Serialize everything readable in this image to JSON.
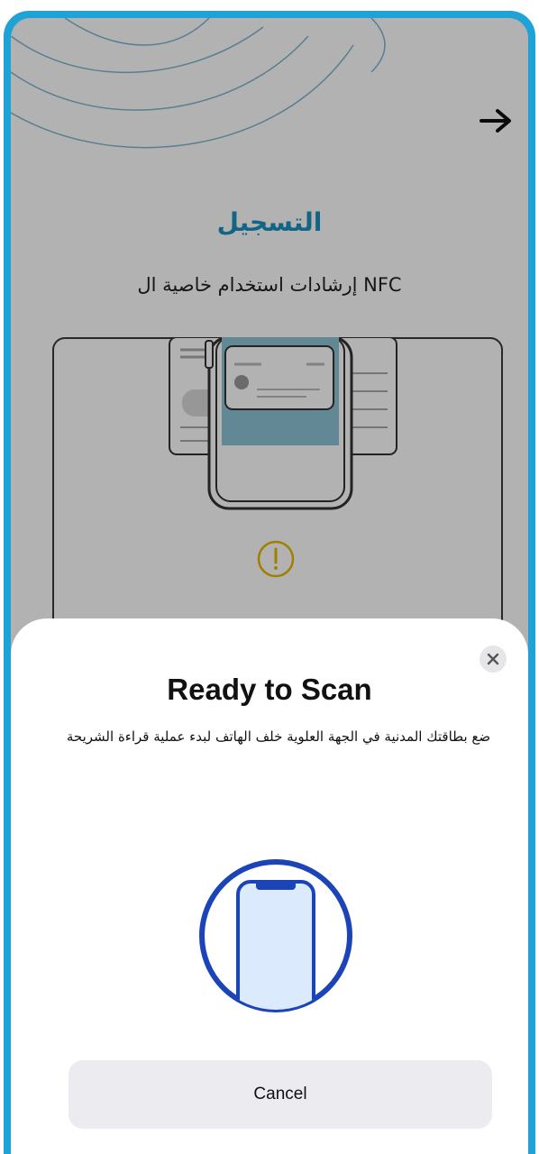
{
  "header": {
    "forward_icon": "arrow-right-icon"
  },
  "main": {
    "title": "التسجيل",
    "subtitle": "إرشادات استخدام خاصية ال NFC",
    "illustration_icon": "card-on-phone-illustration",
    "warning_icon": "warning-circle-icon"
  },
  "sheet": {
    "title": "Ready to Scan",
    "description": "ضع بطاقتك المدنية في الجهة العلوية خلف الهاتف لبدء عملية قراءة الشريحة",
    "close_icon": "close-icon",
    "phone_icon": "phone-in-circle-icon",
    "cancel_label": "Cancel"
  },
  "colors": {
    "frame": "#1fa3d6",
    "title": "#1a91bf",
    "phone_icon": "#1a44b8",
    "phone_fill": "#dbeafc"
  }
}
